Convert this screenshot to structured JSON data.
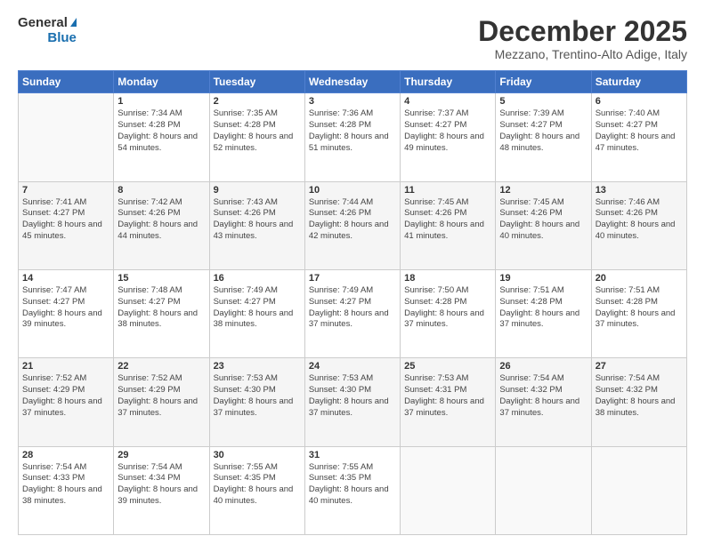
{
  "logo": {
    "line1": "General",
    "line2": "Blue"
  },
  "header": {
    "month": "December 2025",
    "location": "Mezzano, Trentino-Alto Adige, Italy"
  },
  "weekdays": [
    "Sunday",
    "Monday",
    "Tuesday",
    "Wednesday",
    "Thursday",
    "Friday",
    "Saturday"
  ],
  "weeks": [
    [
      {
        "day": "",
        "sunrise": "",
        "sunset": "",
        "daylight": ""
      },
      {
        "day": "1",
        "sunrise": "Sunrise: 7:34 AM",
        "sunset": "Sunset: 4:28 PM",
        "daylight": "Daylight: 8 hours and 54 minutes."
      },
      {
        "day": "2",
        "sunrise": "Sunrise: 7:35 AM",
        "sunset": "Sunset: 4:28 PM",
        "daylight": "Daylight: 8 hours and 52 minutes."
      },
      {
        "day": "3",
        "sunrise": "Sunrise: 7:36 AM",
        "sunset": "Sunset: 4:28 PM",
        "daylight": "Daylight: 8 hours and 51 minutes."
      },
      {
        "day": "4",
        "sunrise": "Sunrise: 7:37 AM",
        "sunset": "Sunset: 4:27 PM",
        "daylight": "Daylight: 8 hours and 49 minutes."
      },
      {
        "day": "5",
        "sunrise": "Sunrise: 7:39 AM",
        "sunset": "Sunset: 4:27 PM",
        "daylight": "Daylight: 8 hours and 48 minutes."
      },
      {
        "day": "6",
        "sunrise": "Sunrise: 7:40 AM",
        "sunset": "Sunset: 4:27 PM",
        "daylight": "Daylight: 8 hours and 47 minutes."
      }
    ],
    [
      {
        "day": "7",
        "sunrise": "Sunrise: 7:41 AM",
        "sunset": "Sunset: 4:27 PM",
        "daylight": "Daylight: 8 hours and 45 minutes."
      },
      {
        "day": "8",
        "sunrise": "Sunrise: 7:42 AM",
        "sunset": "Sunset: 4:26 PM",
        "daylight": "Daylight: 8 hours and 44 minutes."
      },
      {
        "day": "9",
        "sunrise": "Sunrise: 7:43 AM",
        "sunset": "Sunset: 4:26 PM",
        "daylight": "Daylight: 8 hours and 43 minutes."
      },
      {
        "day": "10",
        "sunrise": "Sunrise: 7:44 AM",
        "sunset": "Sunset: 4:26 PM",
        "daylight": "Daylight: 8 hours and 42 minutes."
      },
      {
        "day": "11",
        "sunrise": "Sunrise: 7:45 AM",
        "sunset": "Sunset: 4:26 PM",
        "daylight": "Daylight: 8 hours and 41 minutes."
      },
      {
        "day": "12",
        "sunrise": "Sunrise: 7:45 AM",
        "sunset": "Sunset: 4:26 PM",
        "daylight": "Daylight: 8 hours and 40 minutes."
      },
      {
        "day": "13",
        "sunrise": "Sunrise: 7:46 AM",
        "sunset": "Sunset: 4:26 PM",
        "daylight": "Daylight: 8 hours and 40 minutes."
      }
    ],
    [
      {
        "day": "14",
        "sunrise": "Sunrise: 7:47 AM",
        "sunset": "Sunset: 4:27 PM",
        "daylight": "Daylight: 8 hours and 39 minutes."
      },
      {
        "day": "15",
        "sunrise": "Sunrise: 7:48 AM",
        "sunset": "Sunset: 4:27 PM",
        "daylight": "Daylight: 8 hours and 38 minutes."
      },
      {
        "day": "16",
        "sunrise": "Sunrise: 7:49 AM",
        "sunset": "Sunset: 4:27 PM",
        "daylight": "Daylight: 8 hours and 38 minutes."
      },
      {
        "day": "17",
        "sunrise": "Sunrise: 7:49 AM",
        "sunset": "Sunset: 4:27 PM",
        "daylight": "Daylight: 8 hours and 37 minutes."
      },
      {
        "day": "18",
        "sunrise": "Sunrise: 7:50 AM",
        "sunset": "Sunset: 4:28 PM",
        "daylight": "Daylight: 8 hours and 37 minutes."
      },
      {
        "day": "19",
        "sunrise": "Sunrise: 7:51 AM",
        "sunset": "Sunset: 4:28 PM",
        "daylight": "Daylight: 8 hours and 37 minutes."
      },
      {
        "day": "20",
        "sunrise": "Sunrise: 7:51 AM",
        "sunset": "Sunset: 4:28 PM",
        "daylight": "Daylight: 8 hours and 37 minutes."
      }
    ],
    [
      {
        "day": "21",
        "sunrise": "Sunrise: 7:52 AM",
        "sunset": "Sunset: 4:29 PM",
        "daylight": "Daylight: 8 hours and 37 minutes."
      },
      {
        "day": "22",
        "sunrise": "Sunrise: 7:52 AM",
        "sunset": "Sunset: 4:29 PM",
        "daylight": "Daylight: 8 hours and 37 minutes."
      },
      {
        "day": "23",
        "sunrise": "Sunrise: 7:53 AM",
        "sunset": "Sunset: 4:30 PM",
        "daylight": "Daylight: 8 hours and 37 minutes."
      },
      {
        "day": "24",
        "sunrise": "Sunrise: 7:53 AM",
        "sunset": "Sunset: 4:30 PM",
        "daylight": "Daylight: 8 hours and 37 minutes."
      },
      {
        "day": "25",
        "sunrise": "Sunrise: 7:53 AM",
        "sunset": "Sunset: 4:31 PM",
        "daylight": "Daylight: 8 hours and 37 minutes."
      },
      {
        "day": "26",
        "sunrise": "Sunrise: 7:54 AM",
        "sunset": "Sunset: 4:32 PM",
        "daylight": "Daylight: 8 hours and 37 minutes."
      },
      {
        "day": "27",
        "sunrise": "Sunrise: 7:54 AM",
        "sunset": "Sunset: 4:32 PM",
        "daylight": "Daylight: 8 hours and 38 minutes."
      }
    ],
    [
      {
        "day": "28",
        "sunrise": "Sunrise: 7:54 AM",
        "sunset": "Sunset: 4:33 PM",
        "daylight": "Daylight: 8 hours and 38 minutes."
      },
      {
        "day": "29",
        "sunrise": "Sunrise: 7:54 AM",
        "sunset": "Sunset: 4:34 PM",
        "daylight": "Daylight: 8 hours and 39 minutes."
      },
      {
        "day": "30",
        "sunrise": "Sunrise: 7:55 AM",
        "sunset": "Sunset: 4:35 PM",
        "daylight": "Daylight: 8 hours and 40 minutes."
      },
      {
        "day": "31",
        "sunrise": "Sunrise: 7:55 AM",
        "sunset": "Sunset: 4:35 PM",
        "daylight": "Daylight: 8 hours and 40 minutes."
      },
      {
        "day": "",
        "sunrise": "",
        "sunset": "",
        "daylight": ""
      },
      {
        "day": "",
        "sunrise": "",
        "sunset": "",
        "daylight": ""
      },
      {
        "day": "",
        "sunrise": "",
        "sunset": "",
        "daylight": ""
      }
    ]
  ]
}
